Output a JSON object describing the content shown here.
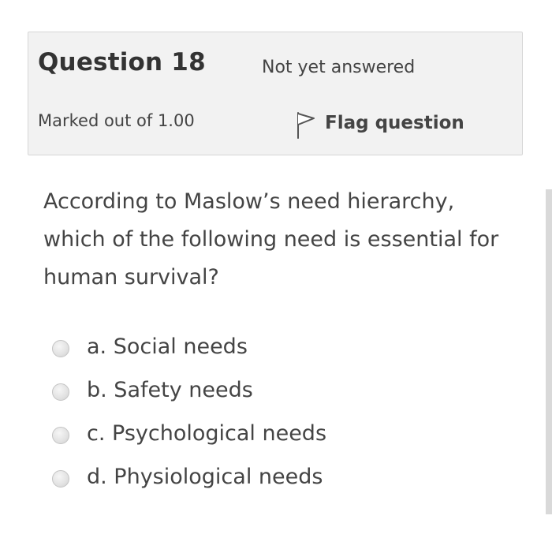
{
  "info": {
    "question_title": "Question 18",
    "state": "Not yet answered",
    "grade": "Marked out of 1.00",
    "flag_label": "Flag question",
    "flag_icon": "flag-icon"
  },
  "question": {
    "text": "According to Maslow’s need hierarchy, which of the following need is essential for human survival?"
  },
  "answers": [
    {
      "label": "a. Social needs"
    },
    {
      "label": "b. Safety needs"
    },
    {
      "label": "c. Psychological needs"
    },
    {
      "label": "d. Physiological needs"
    }
  ]
}
